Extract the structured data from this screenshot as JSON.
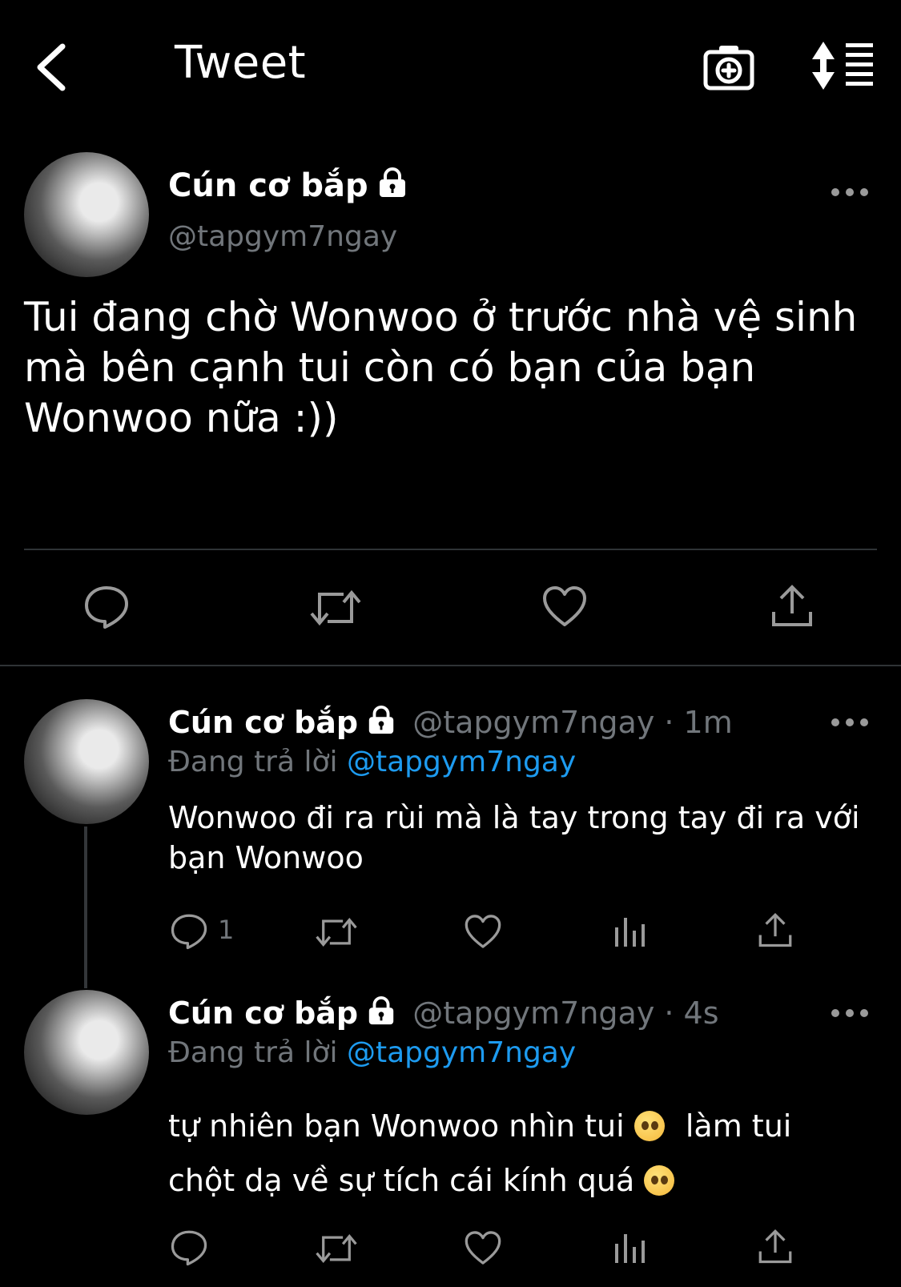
{
  "header": {
    "title": "Tweet",
    "icons": [
      "back-arrow-icon",
      "camera-add-icon",
      "sort-icon"
    ]
  },
  "main_tweet": {
    "name": "Cún cơ bắp",
    "handle": "@tapgym7ngay",
    "text": "Tui đang chờ Wonwoo ở trước nhà vệ sinh mà bên cạnh tui còn có bạn của bạn Wonwoo nữa :))"
  },
  "replies": [
    {
      "name": "Cún cơ bắp",
      "meta": "@tapgym7ngay · 1m",
      "replying_label": "Đang trả lời",
      "replying_to": "@tapgym7ngay",
      "text": "Wonwoo đi ra rùi mà là tay trong tay đi ra với bạn Wonwoo",
      "reply_count": "1"
    },
    {
      "name": "Cún cơ bắp",
      "meta": "@tapgym7ngay · 4s",
      "replying_label": "Đang trả lời",
      "replying_to": "@tapgym7ngay",
      "text_part1": "tự nhiên bạn Wonwoo nhìn tui",
      "text_part2": "làm tui",
      "text_part3": "chột dạ về sự tích cái kính quá",
      "emojis": [
        "pleading-face",
        "crying-face"
      ]
    }
  ],
  "colors": {
    "background": "#000000",
    "text": "#ffffff",
    "secondary": "#71767b",
    "accent": "#1d9bf0",
    "divider": "#2f3336"
  }
}
